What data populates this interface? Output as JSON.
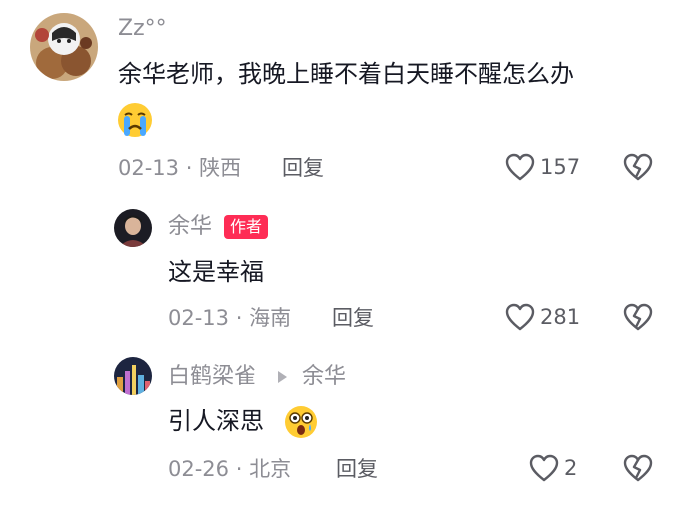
{
  "comment": {
    "username": "Zz°°",
    "text": "余华老师，我晚上睡不着白天睡不醒怎么办",
    "emoji": "crying-face",
    "date": "02-13",
    "location": "陕西",
    "reply_label": "回复",
    "likes": "157"
  },
  "reply1": {
    "username": "余华",
    "badge": "作者",
    "text": "这是幸福",
    "date": "02-13",
    "location": "海南",
    "reply_label": "回复",
    "likes": "281"
  },
  "reply2": {
    "username": "白鹤梁雀",
    "reply_to": "余华",
    "text": "引人深思",
    "emoji": "astonished-face",
    "date": "02-26",
    "location": "北京",
    "reply_label": "回复",
    "likes": "2"
  },
  "separator": "·",
  "colors": {
    "badge": "#fe2c55",
    "text": "#161823",
    "meta": "#8d8d94"
  }
}
